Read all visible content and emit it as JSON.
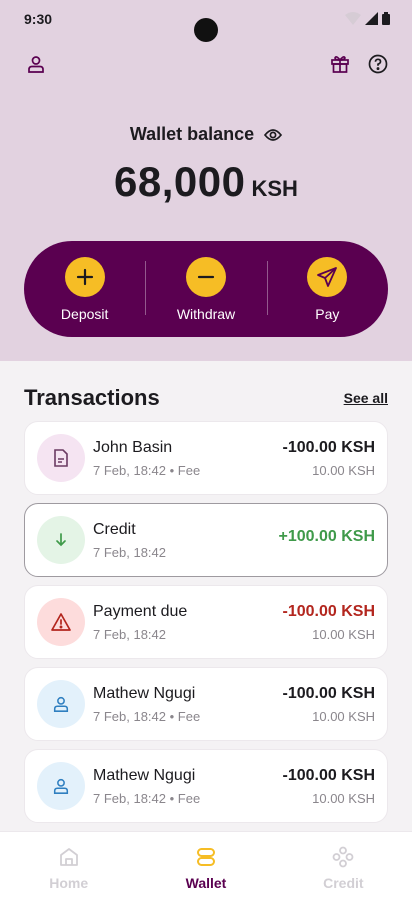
{
  "status": {
    "time": "9:30"
  },
  "header": {
    "profile_icon": "person-icon",
    "gift_icon": "gift-icon",
    "help_icon": "help-icon"
  },
  "wallet": {
    "label": "Wallet balance",
    "amount": "68,000",
    "currency": "KSH"
  },
  "actions": [
    {
      "label": "Deposit",
      "icon": "plus-icon"
    },
    {
      "label": "Withdraw",
      "icon": "minus-icon"
    },
    {
      "label": "Pay",
      "icon": "send-icon"
    }
  ],
  "transactions": {
    "title": "Transactions",
    "see_all": "See all",
    "items": [
      {
        "name": "John Basin",
        "sub": "7 Feb, 18:42 • Fee",
        "amount": "-100.00 KSH",
        "fee": "10.00 KSH",
        "icon": "document-icon",
        "icon_bg": "#f5e4f2",
        "icon_color": "#6b3b63",
        "amount_color": "#1c1b1f"
      },
      {
        "name": "Credit",
        "sub": "7 Feb, 18:42",
        "amount": "+100.00 KSH",
        "fee": "",
        "icon": "arrow-down-icon",
        "icon_bg": "#e4f4e6",
        "icon_color": "#3f9a4a",
        "amount_color": "#3f9a4a"
      },
      {
        "name": "Payment due",
        "sub": "7 Feb, 18:42",
        "amount": "-100.00 KSH",
        "fee": "10.00 KSH",
        "icon": "warning-icon",
        "icon_bg": "#fddcdc",
        "icon_color": "#b3261e",
        "amount_color": "#b3261e"
      },
      {
        "name": "Mathew Ngugi",
        "sub": "7 Feb, 18:42 • Fee",
        "amount": "-100.00 KSH",
        "fee": "10.00 KSH",
        "icon": "person-icon",
        "icon_bg": "#e3f1fb",
        "icon_color": "#2f7fc0",
        "amount_color": "#1c1b1f"
      },
      {
        "name": "Mathew Ngugi",
        "sub": "7 Feb, 18:42 • Fee",
        "amount": "-100.00 KSH",
        "fee": "10.00 KSH",
        "icon": "person-icon",
        "icon_bg": "#e3f1fb",
        "icon_color": "#2f7fc0",
        "amount_color": "#1c1b1f"
      }
    ]
  },
  "nav": [
    {
      "label": "Home",
      "icon": "home-icon",
      "active": false
    },
    {
      "label": "Wallet",
      "icon": "wallet-icon",
      "active": true
    },
    {
      "label": "Credit",
      "icon": "credit-icon",
      "active": false
    }
  ],
  "colors": {
    "brand": "#5a0050",
    "accent": "#f6bd25",
    "header_bg": "#e2d2e0",
    "nav_inactive": "#d2cfd4"
  }
}
